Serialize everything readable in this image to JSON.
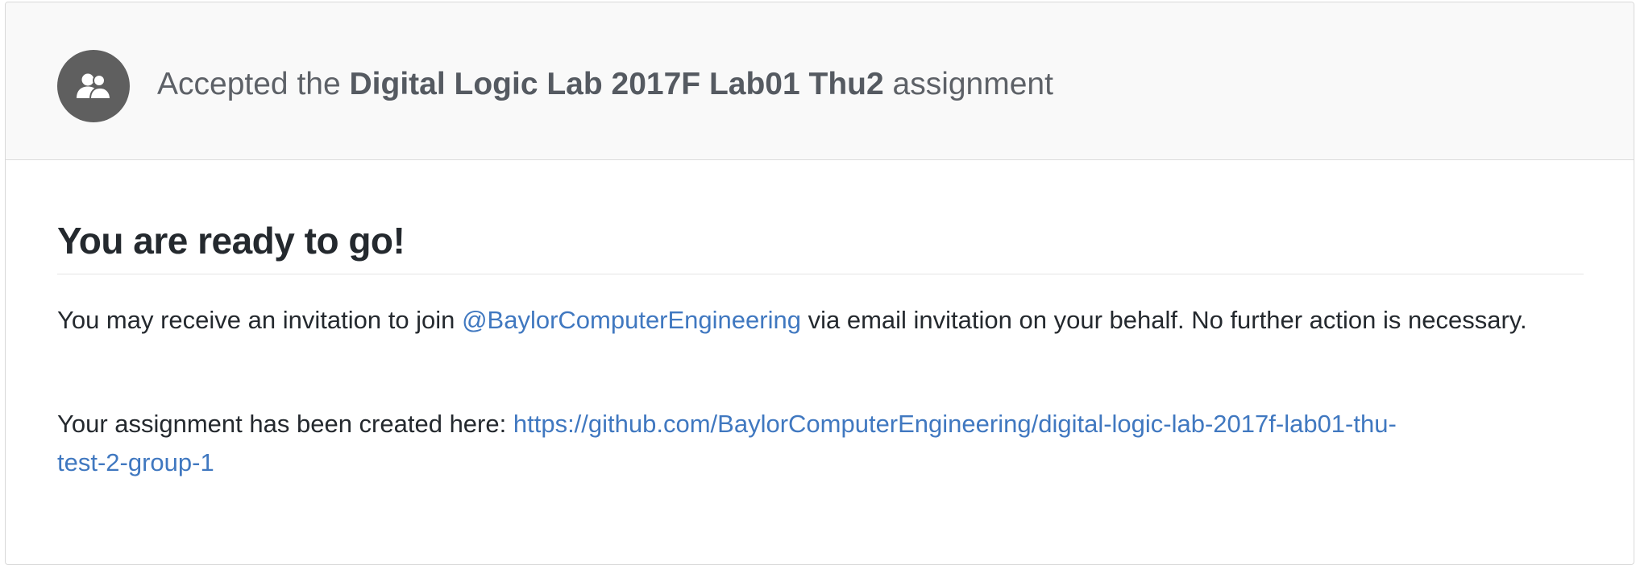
{
  "header": {
    "prefix": "Accepted the",
    "assignment_name": "Digital Logic Lab 2017F Lab01 Thu2",
    "suffix": "assignment",
    "avatar_icon": "group-icon"
  },
  "body": {
    "heading": "You are ready to go!",
    "invitation": {
      "before": "You may receive an invitation to join",
      "org_link": "@BaylorComputerEngineering",
      "after": "via email invitation on your behalf. No further action is necessary."
    },
    "created": {
      "before": "Your assignment has been created here:",
      "url_line1": "https://github.com/BaylorComputerEngineering/digital-logic-lab-2017f-lab01-thu-",
      "url_line2": "test-2-group-1"
    }
  },
  "colors": {
    "link": "#4078c0",
    "header_bg": "#f9f9f9",
    "avatar_bg": "#5f5f5f"
  }
}
